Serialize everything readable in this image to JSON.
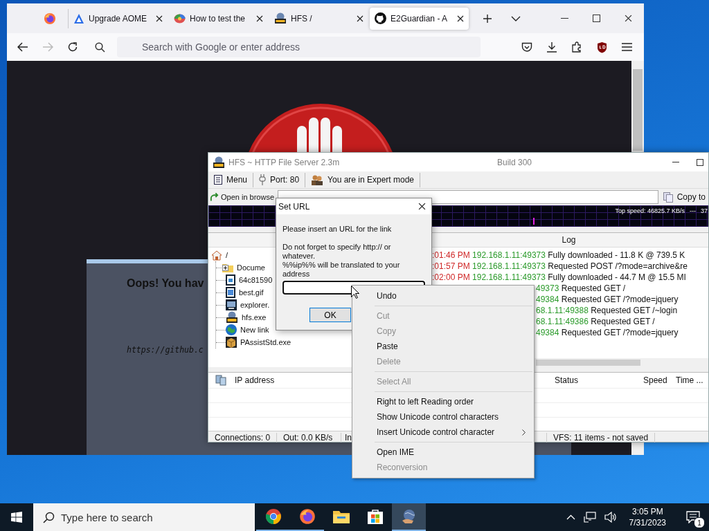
{
  "browser": {
    "tabs": [
      {
        "kind": "pinned",
        "selected": false
      },
      {
        "kind": "page",
        "title": "Upgrade AOME",
        "selected": false
      },
      {
        "kind": "page",
        "title": "How to test the",
        "selected": false
      },
      {
        "kind": "page",
        "title": "HFS /",
        "selected": false
      },
      {
        "kind": "page",
        "title": "E2Guardian - A",
        "selected": true
      }
    ],
    "address_bar": {
      "placeholder": "Search with Google or enter address"
    },
    "page": {
      "heading": "Oops! You hav",
      "link": "https://github.c"
    }
  },
  "hfs": {
    "title": "HFS ~ HTTP File Server 2.3m",
    "build": "Build 300",
    "toolbar": [
      "Menu",
      "Port: 80",
      "You are in Expert mode"
    ],
    "open_in_browser": "Open in browse",
    "copy_button": "Copy to",
    "graph": {
      "top_speed": "Top speed: 46825.7 KB/s",
      "separator": "---",
      "value": "37"
    },
    "tree": {
      "label": "/",
      "children": [
        {
          "label": "Docume",
          "expanded": false
        },
        {
          "label": "64c81590"
        },
        {
          "label": "best.gif"
        },
        {
          "label": "explorer."
        },
        {
          "label": "hfs.exe"
        },
        {
          "label": "New link"
        },
        {
          "label": "PAssistStd.exe"
        }
      ]
    },
    "log": {
      "header": "Log",
      "rows": [
        {
          "kind": "full",
          "time": ":01:46 PM",
          "address": "192.168.1.11:49373",
          "message": "Fully downloaded - 11.8 K @ 739.5 K"
        },
        {
          "kind": "full",
          "time": ":01:57 PM",
          "address": "192.168.1.11:49373",
          "message": "Requested POST /?mode=archive&re"
        },
        {
          "kind": "full",
          "time": ":02:00 PM",
          "address": "192.168.1.11:49373",
          "message": "Fully downloaded - 44.7 M @ 15.5 MI"
        },
        {
          "kind": "covered",
          "address": "49373",
          "message": "Requested GET /"
        },
        {
          "kind": "covered",
          "address": "49384",
          "message": "Requested GET /?mode=jquery"
        },
        {
          "kind": "covered",
          "address": "68.1.11:49388",
          "message": "Requested GET /~login"
        },
        {
          "kind": "covered",
          "address": "68.1.11:49386",
          "message": "Requested GET /"
        },
        {
          "kind": "covered",
          "address": "49384",
          "message": "Requested GET /?mode=jquery"
        }
      ]
    },
    "connections": {
      "columns": [
        "IP address",
        "Status",
        "Speed",
        "Time ..."
      ]
    },
    "status_bar": [
      "Connections: 0",
      "Out: 0.0 KB/s",
      "In",
      "VFS: 11 items - not saved"
    ]
  },
  "dialog": {
    "title": "Set URL",
    "lines": [
      "Please insert an URL for the link",
      "Do not forget to specify http:// or whatever.",
      "%%ip%% will be translated to your address"
    ],
    "ok": "OK"
  },
  "context_menu": {
    "items": [
      {
        "kind": "item",
        "label": "Undo",
        "disabled": false,
        "submenu": false
      },
      {
        "kind": "separator"
      },
      {
        "kind": "item",
        "label": "Cut",
        "disabled": true,
        "submenu": false
      },
      {
        "kind": "item",
        "label": "Copy",
        "disabled": true,
        "submenu": false
      },
      {
        "kind": "item",
        "label": "Paste",
        "disabled": false,
        "submenu": false
      },
      {
        "kind": "item",
        "label": "Delete",
        "disabled": true,
        "submenu": false
      },
      {
        "kind": "separator"
      },
      {
        "kind": "item",
        "label": "Select All",
        "disabled": true,
        "submenu": false
      },
      {
        "kind": "separator"
      },
      {
        "kind": "item",
        "label": "Right to left Reading order",
        "disabled": false,
        "submenu": false
      },
      {
        "kind": "item",
        "label": "Show Unicode control characters",
        "disabled": false,
        "submenu": false
      },
      {
        "kind": "item",
        "label": "Insert Unicode control character",
        "disabled": false,
        "submenu": true
      },
      {
        "kind": "separator"
      },
      {
        "kind": "item",
        "label": "Open IME",
        "disabled": false,
        "submenu": false
      },
      {
        "kind": "item",
        "label": "Reconversion",
        "disabled": true,
        "submenu": false
      }
    ]
  },
  "taskbar": {
    "search": {
      "placeholder": "Type here to search"
    },
    "apps": [
      {
        "running": true,
        "selected": false
      },
      {
        "running": true,
        "selected": false
      },
      {
        "running": false,
        "selected": false
      },
      {
        "running": false,
        "selected": false
      },
      {
        "running": true,
        "selected": true
      }
    ],
    "time": "3:05 PM",
    "date": "7/31/2023",
    "notifications": "1"
  }
}
